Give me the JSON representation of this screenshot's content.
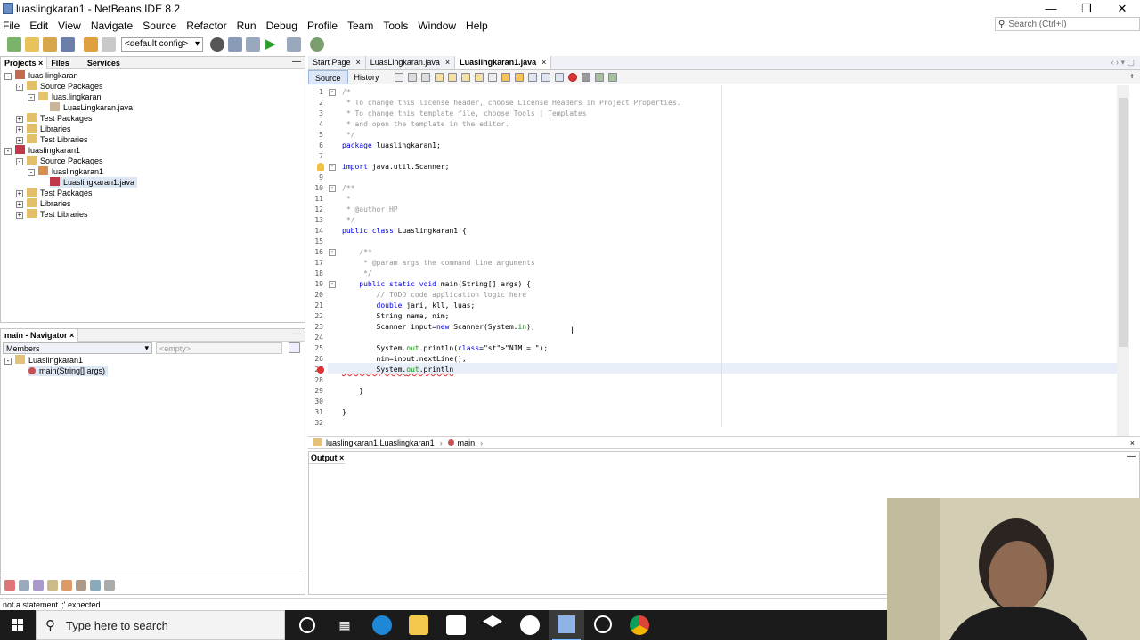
{
  "window": {
    "title": "luaslingkaran1 - NetBeans IDE 8.2"
  },
  "menu": [
    "File",
    "Edit",
    "View",
    "Navigate",
    "Source",
    "Refactor",
    "Run",
    "Debug",
    "Profile",
    "Team",
    "Tools",
    "Window",
    "Help"
  ],
  "search": {
    "placeholder": "Search (Ctrl+I)"
  },
  "toolbar": {
    "config": "<default config>"
  },
  "projects_panel": {
    "tabs": [
      "Projects",
      "Files",
      "Services"
    ],
    "tree": [
      {
        "label": "luas lingkaran",
        "level": 0
      },
      {
        "label": "Source Packages",
        "level": 1
      },
      {
        "label": "luas.lingkaran",
        "level": 2
      },
      {
        "label": "LuasLingkaran.java",
        "level": 3
      },
      {
        "label": "Test Packages",
        "level": 1
      },
      {
        "label": "Libraries",
        "level": 1
      },
      {
        "label": "Test Libraries",
        "level": 1
      },
      {
        "label": "luaslingkaran1",
        "level": 0
      },
      {
        "label": "Source Packages",
        "level": 1
      },
      {
        "label": "luaslingkaran1",
        "level": 2
      },
      {
        "label": "Luaslingkaran1.java",
        "level": 3
      },
      {
        "label": "Test Packages",
        "level": 1
      },
      {
        "label": "Libraries",
        "level": 1
      },
      {
        "label": "Test Libraries",
        "level": 1
      }
    ]
  },
  "navigator": {
    "title": "main - Navigator",
    "filter": "Members",
    "empty_placeholder": "<empty>",
    "class_name": "Luaslingkaran1",
    "method": "main(String[] args)"
  },
  "editor": {
    "tabs": [
      {
        "label": "Start Page",
        "active": false
      },
      {
        "label": "LuasLingkaran.java",
        "active": false
      },
      {
        "label": "Luaslingkaran1.java",
        "active": true
      }
    ],
    "source_tab": "Source",
    "history_tab": "History",
    "lines": [
      {
        "n": "1",
        "text": "/*",
        "cls": "cm"
      },
      {
        "n": "2",
        "text": " * To change this license header, choose License Headers in Project Properties.",
        "cls": "cm"
      },
      {
        "n": "3",
        "text": " * To change this template file, choose Tools | Templates",
        "cls": "cm"
      },
      {
        "n": "4",
        "text": " * and open the template in the editor.",
        "cls": "cm"
      },
      {
        "n": "5",
        "text": " */",
        "cls": "cm"
      },
      {
        "n": "6",
        "text": "package luaslingkaran1;",
        "cls": ""
      },
      {
        "n": "7",
        "text": "",
        "cls": ""
      },
      {
        "n": "8",
        "text": "import java.util.Scanner;",
        "cls": ""
      },
      {
        "n": "9",
        "text": "",
        "cls": ""
      },
      {
        "n": "10",
        "text": "/**",
        "cls": "cm"
      },
      {
        "n": "11",
        "text": " *",
        "cls": "cm"
      },
      {
        "n": "12",
        "text": " * @author HP",
        "cls": "cm"
      },
      {
        "n": "13",
        "text": " */",
        "cls": "cm"
      },
      {
        "n": "14",
        "text": "public class Luaslingkaran1 {",
        "cls": ""
      },
      {
        "n": "15",
        "text": "",
        "cls": ""
      },
      {
        "n": "16",
        "text": "    /**",
        "cls": "cm"
      },
      {
        "n": "17",
        "text": "     * @param args the command line arguments",
        "cls": "cm"
      },
      {
        "n": "18",
        "text": "     */",
        "cls": "cm"
      },
      {
        "n": "19",
        "text": "    public static void main(String[] args) {",
        "cls": ""
      },
      {
        "n": "20",
        "text": "        // TODO code application logic here",
        "cls": "cm"
      },
      {
        "n": "21",
        "text": "        double jari, kll, luas;",
        "cls": ""
      },
      {
        "n": "22",
        "text": "        String nama, nim;",
        "cls": ""
      },
      {
        "n": "23",
        "text": "        Scanner input=new Scanner(System.in);",
        "cls": ""
      },
      {
        "n": "24",
        "text": "",
        "cls": ""
      },
      {
        "n": "25",
        "text": "        System.out.println(\"NIM = \");",
        "cls": ""
      },
      {
        "n": "26",
        "text": "        nim=input.nextLine();",
        "cls": ""
      },
      {
        "n": "27",
        "text": "        System.out.println",
        "cls": ""
      },
      {
        "n": "28",
        "text": "",
        "cls": ""
      },
      {
        "n": "29",
        "text": "    }",
        "cls": ""
      },
      {
        "n": "30",
        "text": "",
        "cls": ""
      },
      {
        "n": "31",
        "text": "}",
        "cls": ""
      },
      {
        "n": "32",
        "text": "",
        "cls": ""
      }
    ],
    "breadcrumb": [
      "luaslingkaran1.Luaslingkaran1",
      "main"
    ]
  },
  "output": {
    "tab": "Output"
  },
  "status": {
    "message": "not a statement  ';' expected"
  },
  "taskbar": {
    "search_placeholder": "Type here to search"
  }
}
